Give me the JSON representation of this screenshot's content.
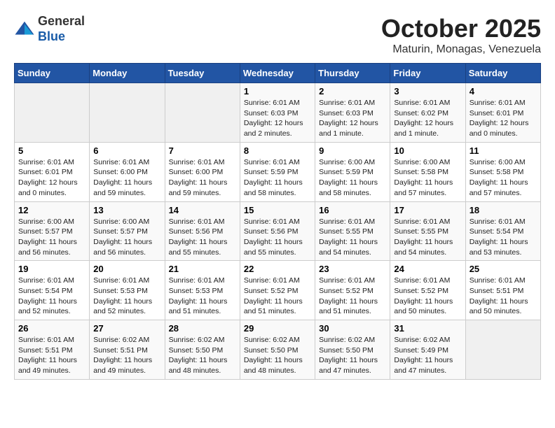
{
  "header": {
    "logo": {
      "general": "General",
      "blue": "Blue"
    },
    "title": "October 2025",
    "subtitle": "Maturin, Monagas, Venezuela"
  },
  "days_of_week": [
    "Sunday",
    "Monday",
    "Tuesday",
    "Wednesday",
    "Thursday",
    "Friday",
    "Saturday"
  ],
  "weeks": [
    [
      {
        "day": null
      },
      {
        "day": null
      },
      {
        "day": null
      },
      {
        "day": 1,
        "sunrise": "6:01 AM",
        "sunset": "6:03 PM",
        "daylight": "12 hours and 2 minutes."
      },
      {
        "day": 2,
        "sunrise": "6:01 AM",
        "sunset": "6:03 PM",
        "daylight": "12 hours and 1 minute."
      },
      {
        "day": 3,
        "sunrise": "6:01 AM",
        "sunset": "6:02 PM",
        "daylight": "12 hours and 1 minute."
      },
      {
        "day": 4,
        "sunrise": "6:01 AM",
        "sunset": "6:01 PM",
        "daylight": "12 hours and 0 minutes."
      }
    ],
    [
      {
        "day": 5,
        "sunrise": "6:01 AM",
        "sunset": "6:01 PM",
        "daylight": "12 hours and 0 minutes."
      },
      {
        "day": 6,
        "sunrise": "6:01 AM",
        "sunset": "6:00 PM",
        "daylight": "11 hours and 59 minutes."
      },
      {
        "day": 7,
        "sunrise": "6:01 AM",
        "sunset": "6:00 PM",
        "daylight": "11 hours and 59 minutes."
      },
      {
        "day": 8,
        "sunrise": "6:01 AM",
        "sunset": "5:59 PM",
        "daylight": "11 hours and 58 minutes."
      },
      {
        "day": 9,
        "sunrise": "6:00 AM",
        "sunset": "5:59 PM",
        "daylight": "11 hours and 58 minutes."
      },
      {
        "day": 10,
        "sunrise": "6:00 AM",
        "sunset": "5:58 PM",
        "daylight": "11 hours and 57 minutes."
      },
      {
        "day": 11,
        "sunrise": "6:00 AM",
        "sunset": "5:58 PM",
        "daylight": "11 hours and 57 minutes."
      }
    ],
    [
      {
        "day": 12,
        "sunrise": "6:00 AM",
        "sunset": "5:57 PM",
        "daylight": "11 hours and 56 minutes."
      },
      {
        "day": 13,
        "sunrise": "6:00 AM",
        "sunset": "5:57 PM",
        "daylight": "11 hours and 56 minutes."
      },
      {
        "day": 14,
        "sunrise": "6:01 AM",
        "sunset": "5:56 PM",
        "daylight": "11 hours and 55 minutes."
      },
      {
        "day": 15,
        "sunrise": "6:01 AM",
        "sunset": "5:56 PM",
        "daylight": "11 hours and 55 minutes."
      },
      {
        "day": 16,
        "sunrise": "6:01 AM",
        "sunset": "5:55 PM",
        "daylight": "11 hours and 54 minutes."
      },
      {
        "day": 17,
        "sunrise": "6:01 AM",
        "sunset": "5:55 PM",
        "daylight": "11 hours and 54 minutes."
      },
      {
        "day": 18,
        "sunrise": "6:01 AM",
        "sunset": "5:54 PM",
        "daylight": "11 hours and 53 minutes."
      }
    ],
    [
      {
        "day": 19,
        "sunrise": "6:01 AM",
        "sunset": "5:54 PM",
        "daylight": "11 hours and 52 minutes."
      },
      {
        "day": 20,
        "sunrise": "6:01 AM",
        "sunset": "5:53 PM",
        "daylight": "11 hours and 52 minutes."
      },
      {
        "day": 21,
        "sunrise": "6:01 AM",
        "sunset": "5:53 PM",
        "daylight": "11 hours and 51 minutes."
      },
      {
        "day": 22,
        "sunrise": "6:01 AM",
        "sunset": "5:52 PM",
        "daylight": "11 hours and 51 minutes."
      },
      {
        "day": 23,
        "sunrise": "6:01 AM",
        "sunset": "5:52 PM",
        "daylight": "11 hours and 51 minutes."
      },
      {
        "day": 24,
        "sunrise": "6:01 AM",
        "sunset": "5:52 PM",
        "daylight": "11 hours and 50 minutes."
      },
      {
        "day": 25,
        "sunrise": "6:01 AM",
        "sunset": "5:51 PM",
        "daylight": "11 hours and 50 minutes."
      }
    ],
    [
      {
        "day": 26,
        "sunrise": "6:01 AM",
        "sunset": "5:51 PM",
        "daylight": "11 hours and 49 minutes."
      },
      {
        "day": 27,
        "sunrise": "6:02 AM",
        "sunset": "5:51 PM",
        "daylight": "11 hours and 49 minutes."
      },
      {
        "day": 28,
        "sunrise": "6:02 AM",
        "sunset": "5:50 PM",
        "daylight": "11 hours and 48 minutes."
      },
      {
        "day": 29,
        "sunrise": "6:02 AM",
        "sunset": "5:50 PM",
        "daylight": "11 hours and 48 minutes."
      },
      {
        "day": 30,
        "sunrise": "6:02 AM",
        "sunset": "5:50 PM",
        "daylight": "11 hours and 47 minutes."
      },
      {
        "day": 31,
        "sunrise": "6:02 AM",
        "sunset": "5:49 PM",
        "daylight": "11 hours and 47 minutes."
      },
      {
        "day": null
      }
    ]
  ],
  "labels": {
    "sunrise": "Sunrise:",
    "sunset": "Sunset:",
    "daylight": "Daylight hours"
  }
}
